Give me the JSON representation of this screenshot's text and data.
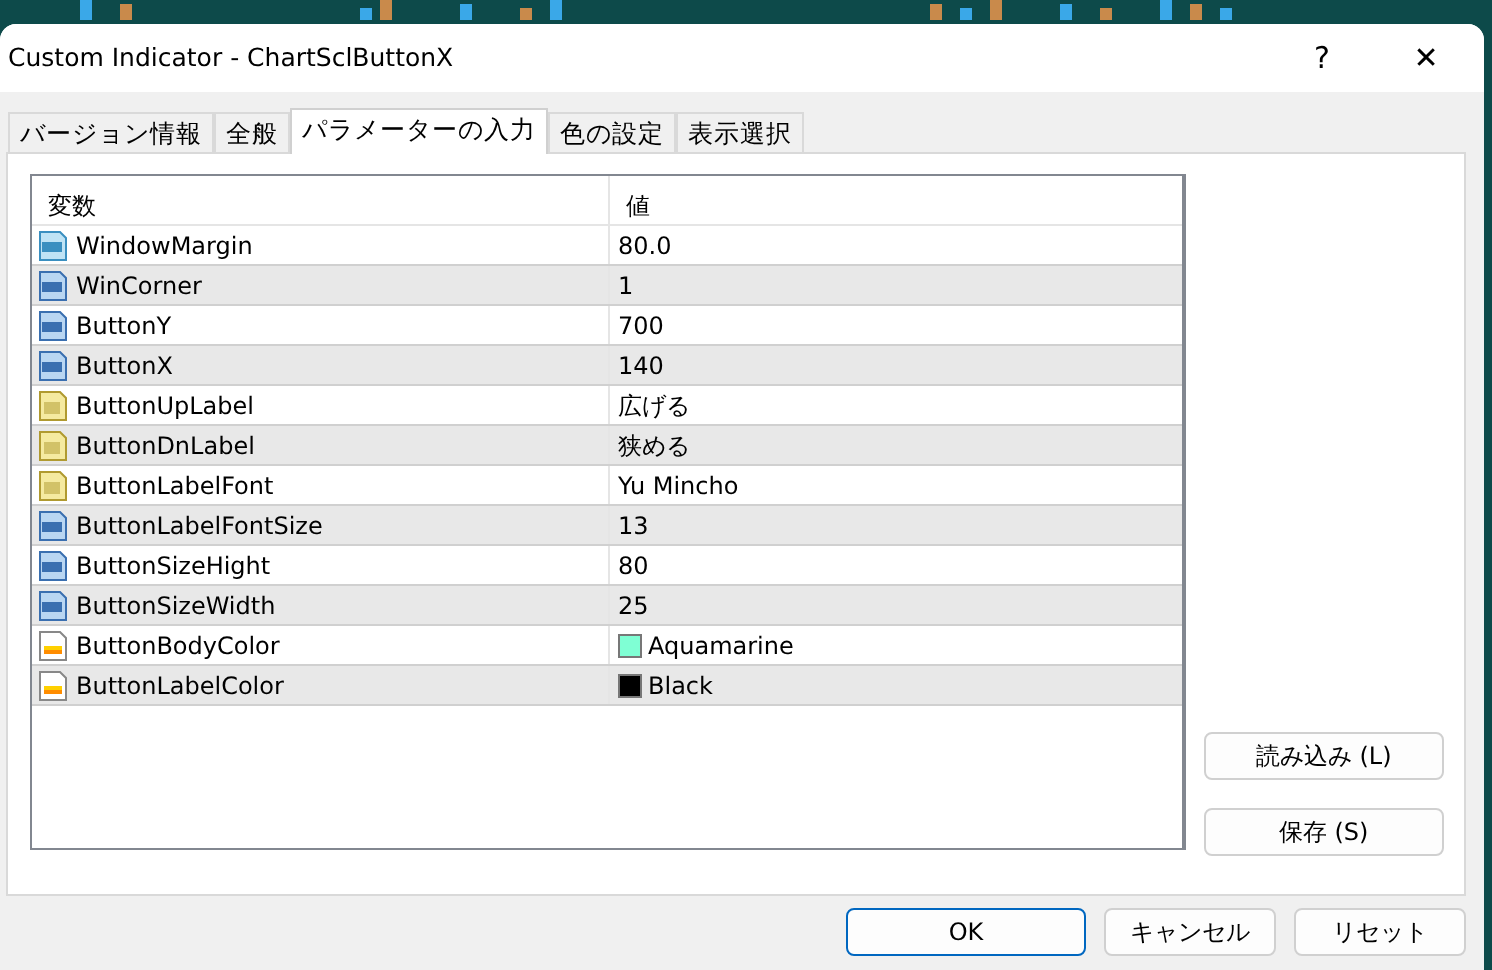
{
  "window": {
    "title": "Custom Indicator - ChartSclButtonX",
    "help": "?",
    "close": "✕"
  },
  "tabs": [
    {
      "label": "バージョン情報",
      "selected": false
    },
    {
      "label": "全般",
      "selected": false
    },
    {
      "label": "パラメーターの入力",
      "selected": true
    },
    {
      "label": "色の設定",
      "selected": false
    },
    {
      "label": "表示選択",
      "selected": false
    }
  ],
  "table": {
    "columns": [
      "変数",
      "値"
    ],
    "rows": [
      {
        "kind": "double",
        "name": "WindowMargin",
        "value": "80.0"
      },
      {
        "kind": "int",
        "name": "WinCorner",
        "value": "1"
      },
      {
        "kind": "int",
        "name": "ButtonY",
        "value": "700"
      },
      {
        "kind": "int",
        "name": "ButtonX",
        "value": "140"
      },
      {
        "kind": "string",
        "name": "ButtonUpLabel",
        "value": "広げる"
      },
      {
        "kind": "string",
        "name": "ButtonDnLabel",
        "value": "狭める"
      },
      {
        "kind": "string",
        "name": "ButtonLabelFont",
        "value": "Yu Mincho"
      },
      {
        "kind": "int",
        "name": "ButtonLabelFontSize",
        "value": "13"
      },
      {
        "kind": "int",
        "name": "ButtonSizeHight",
        "value": "80"
      },
      {
        "kind": "int",
        "name": "ButtonSizeWidth",
        "value": "25"
      },
      {
        "kind": "color",
        "name": "ButtonBodyColor",
        "value": "Aquamarine",
        "color": "#7fffd4"
      },
      {
        "kind": "color",
        "name": "ButtonLabelColor",
        "value": "Black",
        "color": "#000000"
      }
    ]
  },
  "side_buttons": [
    "読み込み (L)",
    "保存 (S)"
  ],
  "footer_buttons": [
    {
      "label": "OK",
      "default": true
    },
    {
      "label": "キャンセル",
      "default": false
    },
    {
      "label": "リセット",
      "default": false
    }
  ]
}
